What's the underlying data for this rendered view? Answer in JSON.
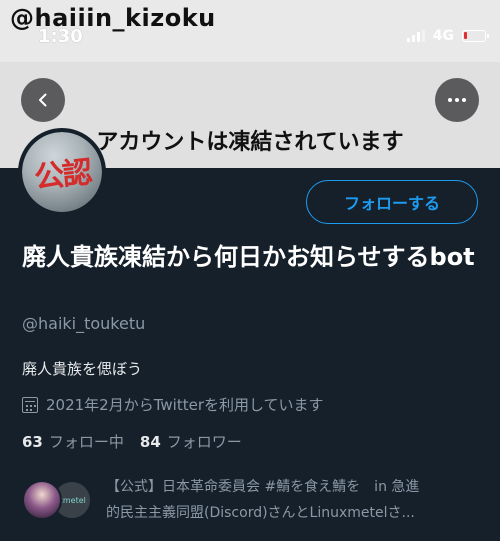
{
  "watermark": "@haiiin_kizoku",
  "status_bar": {
    "time": "1:30",
    "network": "4G",
    "battery_icon": "battery-low-icon"
  },
  "header": {
    "title": "アカウントは凍結されています",
    "back_icon": "chevron-left-icon",
    "more_icon": "more-horizontal-icon"
  },
  "profile": {
    "avatar_text": "公認",
    "follow_label": "フォローする",
    "name": "廃人貴族凍結から何日かお知らせするbot",
    "handle": "@haiki_touketu",
    "bio": "廃人貴族を偲ぼう",
    "joined": "2021年2月からTwitterを利用しています",
    "following_count": "63",
    "following_label": "フォロー中",
    "followers_count": "84",
    "followers_label": "フォロワー",
    "followed_by_line1": "【公式】日本革命委員会 #鯖を食え鯖を　in 急進",
    "followed_by_line2": "的民主主義同盟(Discord)さんとLinuxmetelさ...",
    "second_avatar_text": "xmetel"
  },
  "colors": {
    "background": "#15202b",
    "accent": "#1d9bf0",
    "secondary_text": "#8b98a5"
  }
}
